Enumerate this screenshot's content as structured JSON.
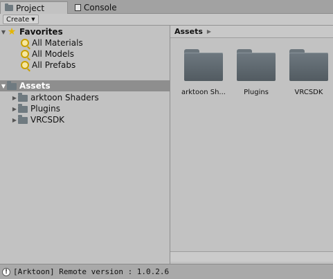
{
  "tabs": [
    {
      "label": "Project",
      "icon": "folder-icon"
    },
    {
      "label": "Console",
      "icon": "console-icon"
    }
  ],
  "toolbar": {
    "create_label": "Create"
  },
  "tree": {
    "favorites": {
      "label": "Favorites",
      "items": [
        "All Materials",
        "All Models",
        "All Prefabs"
      ]
    },
    "assets": {
      "label": "Assets",
      "children": [
        "arktoon Shaders",
        "Plugins",
        "VRCSDK"
      ]
    }
  },
  "browser": {
    "breadcrumb": "Assets",
    "items": [
      "arktoon Sh...",
      "Plugins",
      "VRCSDK"
    ]
  },
  "status": {
    "message": "[Arktoon] Remote version : 1.0.2.6"
  },
  "colors": {
    "selection": "#8e8e8e",
    "folder": "#6e7880"
  }
}
